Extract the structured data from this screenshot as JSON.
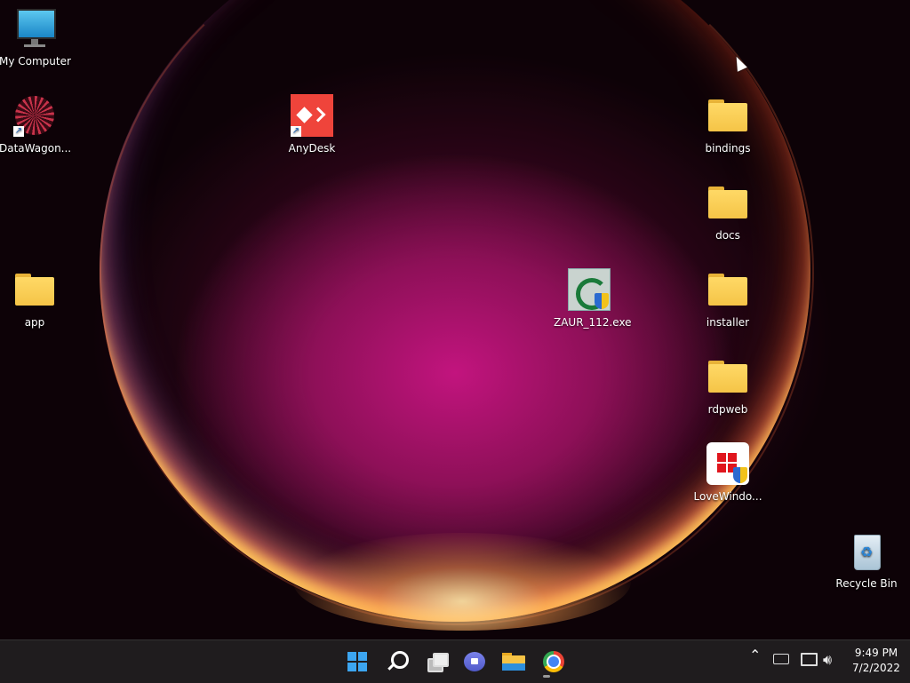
{
  "desktop": {
    "icons": {
      "my_computer": "My Computer",
      "datawagon": "DataWagon...",
      "anydesk": "AnyDesk",
      "app": "app",
      "zaur": "ZAUR_112.exe",
      "bindings": "bindings",
      "docs": "docs",
      "installer": "installer",
      "rdpweb": "rdpweb",
      "lovewindows": "LoveWindo...",
      "recycle_bin": "Recycle Bin"
    }
  },
  "taskbar": {
    "pinned": [
      "start-icon",
      "search-icon",
      "task-view-icon",
      "chat-icon",
      "file-explorer-icon",
      "chrome-icon"
    ],
    "tray": [
      "chevron-up-icon",
      "keyboard-icon",
      "network-icon",
      "volume-icon"
    ],
    "clock": {
      "time": "9:49 PM",
      "date": "7/2/2022"
    }
  },
  "colors": {
    "taskbar_bg": "#1f1c1e",
    "folder_yellow": "#f5c447",
    "accent_blue": "#3ca5f0"
  }
}
